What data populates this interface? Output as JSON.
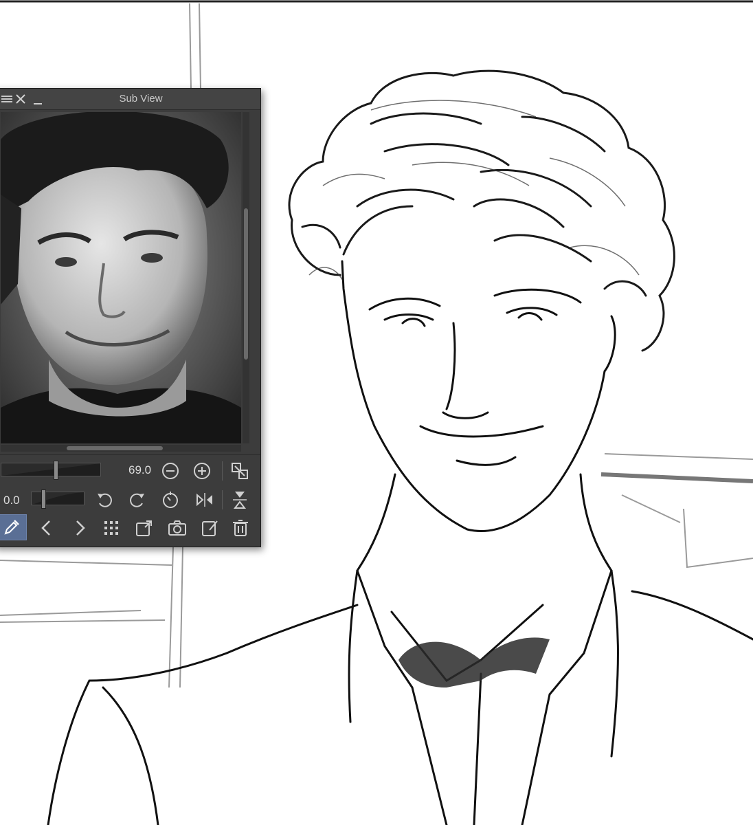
{
  "subview": {
    "title": "Sub View",
    "zoom_value": "69.0",
    "rotation_value": "0.0"
  },
  "icons": {
    "menu": "menu-icon",
    "close": "close-icon",
    "minimize": "minimize-icon",
    "zoom_out": "zoom-out-icon",
    "zoom_in": "zoom-in-icon",
    "fit": "fit-to-window-icon",
    "rotate_left": "rotate-left-icon",
    "rotate_right": "rotate-right-icon",
    "reset_rotation": "reset-rotation-icon",
    "flip_horizontal": "flip-horizontal-icon",
    "flip_vertical": "flip-vertical-icon",
    "eyedropper": "eyedropper-icon",
    "previous": "previous-image-icon",
    "next": "next-image-icon",
    "grid": "image-list-icon",
    "import": "import-image-icon",
    "camera": "camera-icon",
    "edit": "edit-icon",
    "delete": "trash-icon"
  },
  "colors": {
    "panel_bg": "#3c3c3c",
    "titlebar_bg": "#444444",
    "active_tool_bg": "#5a6f95",
    "icon_color": "#d0d0d0"
  }
}
